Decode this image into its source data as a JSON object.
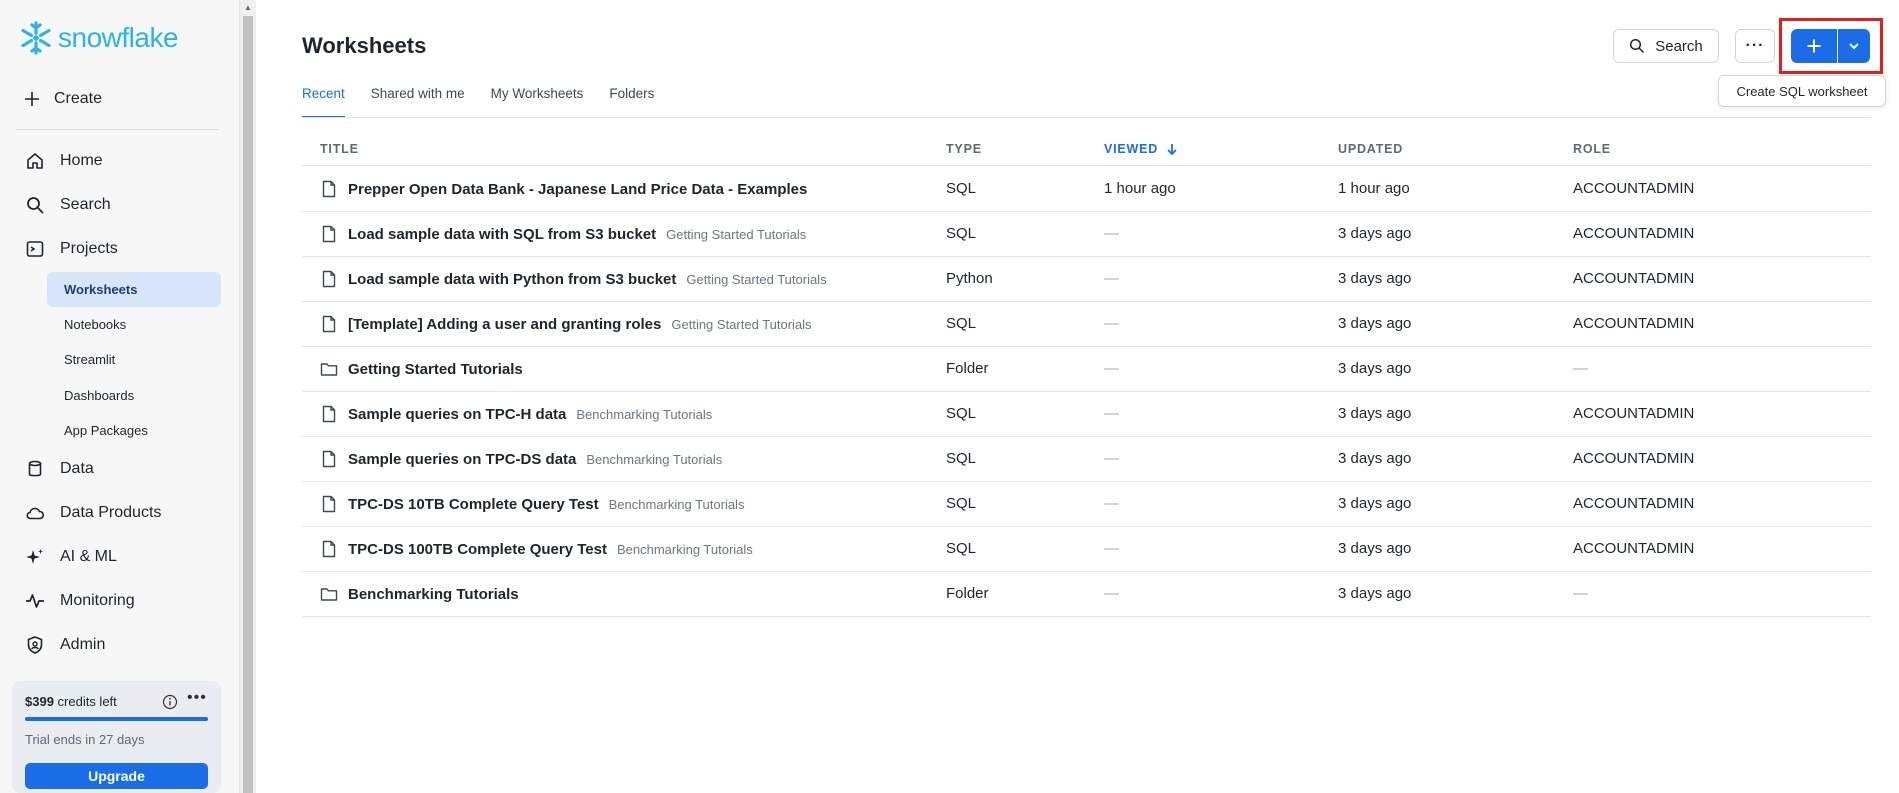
{
  "brand": {
    "name": "snowflake",
    "color": "#29b5e8"
  },
  "sidebar": {
    "create_label": "Create",
    "items": [
      {
        "label": "Home",
        "icon": "home-icon"
      },
      {
        "label": "Search",
        "icon": "search-icon"
      },
      {
        "label": "Projects",
        "icon": "projects-icon"
      },
      {
        "label": "Data",
        "icon": "database-icon"
      },
      {
        "label": "Data Products",
        "icon": "cloud-icon"
      },
      {
        "label": "AI & ML",
        "icon": "sparkle-icon"
      },
      {
        "label": "Monitoring",
        "icon": "activity-icon"
      },
      {
        "label": "Admin",
        "icon": "shield-icon"
      }
    ],
    "sub_items": [
      "Worksheets",
      "Notebooks",
      "Streamlit",
      "Dashboards",
      "App Packages"
    ],
    "active_sub_item": "Worksheets"
  },
  "credits": {
    "amount": "$399",
    "suffix": " credits left",
    "progress": 1.0,
    "trial_text": "Trial ends in 27 days",
    "upgrade_label": "Upgrade"
  },
  "header": {
    "title": "Worksheets",
    "search_label": "Search",
    "tooltip": "Create SQL worksheet"
  },
  "tabs": [
    "Recent",
    "Shared with me",
    "My Worksheets",
    "Folders"
  ],
  "active_tab": "Recent",
  "table": {
    "columns": {
      "title": "TITLE",
      "type": "TYPE",
      "viewed": "VIEWED",
      "updated": "UPDATED",
      "role": "ROLE"
    },
    "rows": [
      {
        "icon": "file-icon",
        "title": "Prepper Open Data Bank - Japanese Land Price Data - Examples",
        "folder": "",
        "type": "SQL",
        "viewed": "1 hour ago",
        "updated": "1 hour ago",
        "role": "ACCOUNTADMIN"
      },
      {
        "icon": "file-icon",
        "title": "Load sample data with SQL from S3 bucket",
        "folder": "Getting Started Tutorials",
        "type": "SQL",
        "viewed": "—",
        "updated": "3 days ago",
        "role": "ACCOUNTADMIN"
      },
      {
        "icon": "file-icon",
        "title": "Load sample data with Python from S3 bucket",
        "folder": "Getting Started Tutorials",
        "type": "Python",
        "viewed": "—",
        "updated": "3 days ago",
        "role": "ACCOUNTADMIN"
      },
      {
        "icon": "file-icon",
        "title": "[Template] Adding a user and granting roles",
        "folder": "Getting Started Tutorials",
        "type": "SQL",
        "viewed": "—",
        "updated": "3 days ago",
        "role": "ACCOUNTADMIN"
      },
      {
        "icon": "folder-icon",
        "title": "Getting Started Tutorials",
        "folder": "",
        "type": "Folder",
        "viewed": "—",
        "updated": "3 days ago",
        "role": "—"
      },
      {
        "icon": "file-icon",
        "title": "Sample queries on TPC-H data",
        "folder": "Benchmarking Tutorials",
        "type": "SQL",
        "viewed": "—",
        "updated": "3 days ago",
        "role": "ACCOUNTADMIN"
      },
      {
        "icon": "file-icon",
        "title": "Sample queries on TPC-DS data",
        "folder": "Benchmarking Tutorials",
        "type": "SQL",
        "viewed": "—",
        "updated": "3 days ago",
        "role": "ACCOUNTADMIN"
      },
      {
        "icon": "file-icon",
        "title": "TPC-DS 10TB Complete Query Test",
        "folder": "Benchmarking Tutorials",
        "type": "SQL",
        "viewed": "—",
        "updated": "3 days ago",
        "role": "ACCOUNTADMIN"
      },
      {
        "icon": "file-icon",
        "title": "TPC-DS 100TB Complete Query Test",
        "folder": "Benchmarking Tutorials",
        "type": "SQL",
        "viewed": "—",
        "updated": "3 days ago",
        "role": "ACCOUNTADMIN"
      },
      {
        "icon": "folder-icon",
        "title": "Benchmarking Tutorials",
        "folder": "",
        "type": "Folder",
        "viewed": "—",
        "updated": "3 days ago",
        "role": "—"
      }
    ]
  }
}
